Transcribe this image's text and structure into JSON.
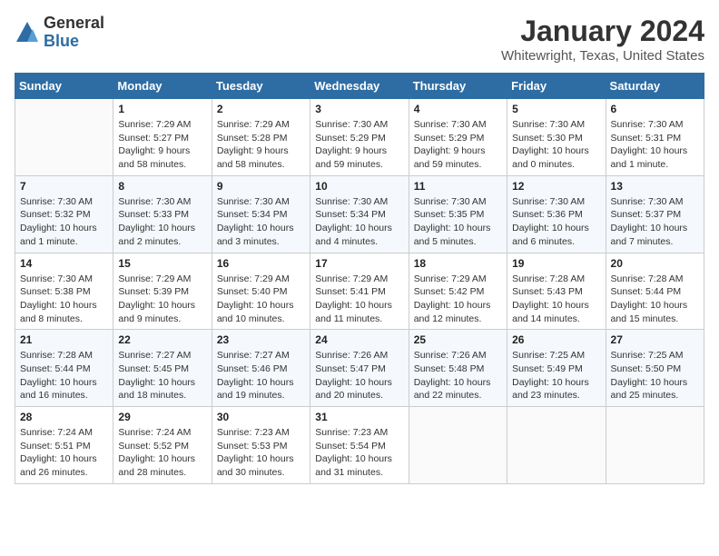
{
  "logo": {
    "general": "General",
    "blue": "Blue"
  },
  "title": "January 2024",
  "location": "Whitewright, Texas, United States",
  "weekdays": [
    "Sunday",
    "Monday",
    "Tuesday",
    "Wednesday",
    "Thursday",
    "Friday",
    "Saturday"
  ],
  "weeks": [
    [
      {
        "day": "",
        "info": ""
      },
      {
        "day": "1",
        "info": "Sunrise: 7:29 AM\nSunset: 5:27 PM\nDaylight: 9 hours\nand 58 minutes."
      },
      {
        "day": "2",
        "info": "Sunrise: 7:29 AM\nSunset: 5:28 PM\nDaylight: 9 hours\nand 58 minutes."
      },
      {
        "day": "3",
        "info": "Sunrise: 7:30 AM\nSunset: 5:29 PM\nDaylight: 9 hours\nand 59 minutes."
      },
      {
        "day": "4",
        "info": "Sunrise: 7:30 AM\nSunset: 5:29 PM\nDaylight: 9 hours\nand 59 minutes."
      },
      {
        "day": "5",
        "info": "Sunrise: 7:30 AM\nSunset: 5:30 PM\nDaylight: 10 hours\nand 0 minutes."
      },
      {
        "day": "6",
        "info": "Sunrise: 7:30 AM\nSunset: 5:31 PM\nDaylight: 10 hours\nand 1 minute."
      }
    ],
    [
      {
        "day": "7",
        "info": "Sunrise: 7:30 AM\nSunset: 5:32 PM\nDaylight: 10 hours\nand 1 minute."
      },
      {
        "day": "8",
        "info": "Sunrise: 7:30 AM\nSunset: 5:33 PM\nDaylight: 10 hours\nand 2 minutes."
      },
      {
        "day": "9",
        "info": "Sunrise: 7:30 AM\nSunset: 5:34 PM\nDaylight: 10 hours\nand 3 minutes."
      },
      {
        "day": "10",
        "info": "Sunrise: 7:30 AM\nSunset: 5:34 PM\nDaylight: 10 hours\nand 4 minutes."
      },
      {
        "day": "11",
        "info": "Sunrise: 7:30 AM\nSunset: 5:35 PM\nDaylight: 10 hours\nand 5 minutes."
      },
      {
        "day": "12",
        "info": "Sunrise: 7:30 AM\nSunset: 5:36 PM\nDaylight: 10 hours\nand 6 minutes."
      },
      {
        "day": "13",
        "info": "Sunrise: 7:30 AM\nSunset: 5:37 PM\nDaylight: 10 hours\nand 7 minutes."
      }
    ],
    [
      {
        "day": "14",
        "info": "Sunrise: 7:30 AM\nSunset: 5:38 PM\nDaylight: 10 hours\nand 8 minutes."
      },
      {
        "day": "15",
        "info": "Sunrise: 7:29 AM\nSunset: 5:39 PM\nDaylight: 10 hours\nand 9 minutes."
      },
      {
        "day": "16",
        "info": "Sunrise: 7:29 AM\nSunset: 5:40 PM\nDaylight: 10 hours\nand 10 minutes."
      },
      {
        "day": "17",
        "info": "Sunrise: 7:29 AM\nSunset: 5:41 PM\nDaylight: 10 hours\nand 11 minutes."
      },
      {
        "day": "18",
        "info": "Sunrise: 7:29 AM\nSunset: 5:42 PM\nDaylight: 10 hours\nand 12 minutes."
      },
      {
        "day": "19",
        "info": "Sunrise: 7:28 AM\nSunset: 5:43 PM\nDaylight: 10 hours\nand 14 minutes."
      },
      {
        "day": "20",
        "info": "Sunrise: 7:28 AM\nSunset: 5:44 PM\nDaylight: 10 hours\nand 15 minutes."
      }
    ],
    [
      {
        "day": "21",
        "info": "Sunrise: 7:28 AM\nSunset: 5:44 PM\nDaylight: 10 hours\nand 16 minutes."
      },
      {
        "day": "22",
        "info": "Sunrise: 7:27 AM\nSunset: 5:45 PM\nDaylight: 10 hours\nand 18 minutes."
      },
      {
        "day": "23",
        "info": "Sunrise: 7:27 AM\nSunset: 5:46 PM\nDaylight: 10 hours\nand 19 minutes."
      },
      {
        "day": "24",
        "info": "Sunrise: 7:26 AM\nSunset: 5:47 PM\nDaylight: 10 hours\nand 20 minutes."
      },
      {
        "day": "25",
        "info": "Sunrise: 7:26 AM\nSunset: 5:48 PM\nDaylight: 10 hours\nand 22 minutes."
      },
      {
        "day": "26",
        "info": "Sunrise: 7:25 AM\nSunset: 5:49 PM\nDaylight: 10 hours\nand 23 minutes."
      },
      {
        "day": "27",
        "info": "Sunrise: 7:25 AM\nSunset: 5:50 PM\nDaylight: 10 hours\nand 25 minutes."
      }
    ],
    [
      {
        "day": "28",
        "info": "Sunrise: 7:24 AM\nSunset: 5:51 PM\nDaylight: 10 hours\nand 26 minutes."
      },
      {
        "day": "29",
        "info": "Sunrise: 7:24 AM\nSunset: 5:52 PM\nDaylight: 10 hours\nand 28 minutes."
      },
      {
        "day": "30",
        "info": "Sunrise: 7:23 AM\nSunset: 5:53 PM\nDaylight: 10 hours\nand 30 minutes."
      },
      {
        "day": "31",
        "info": "Sunrise: 7:23 AM\nSunset: 5:54 PM\nDaylight: 10 hours\nand 31 minutes."
      },
      {
        "day": "",
        "info": ""
      },
      {
        "day": "",
        "info": ""
      },
      {
        "day": "",
        "info": ""
      }
    ]
  ]
}
